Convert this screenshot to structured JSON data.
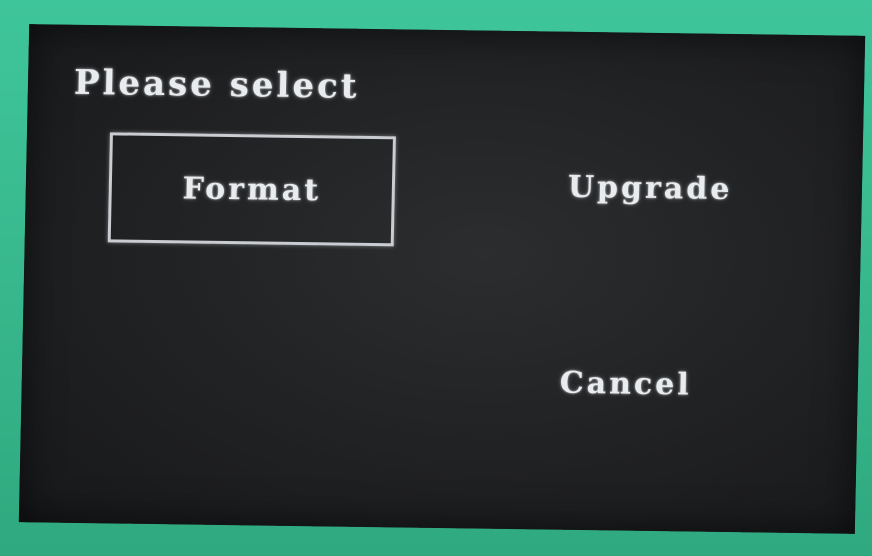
{
  "dialog": {
    "title": "Please select",
    "options": [
      {
        "label": "Format",
        "selected": true
      },
      {
        "label": "Upgrade",
        "selected": false
      },
      {
        "label": "Cancel",
        "selected": false
      }
    ]
  },
  "colors": {
    "bezel": "#3dbf94",
    "screen": "#202123",
    "text": "#e9ecef",
    "selection_border": "#c9ccd0"
  }
}
